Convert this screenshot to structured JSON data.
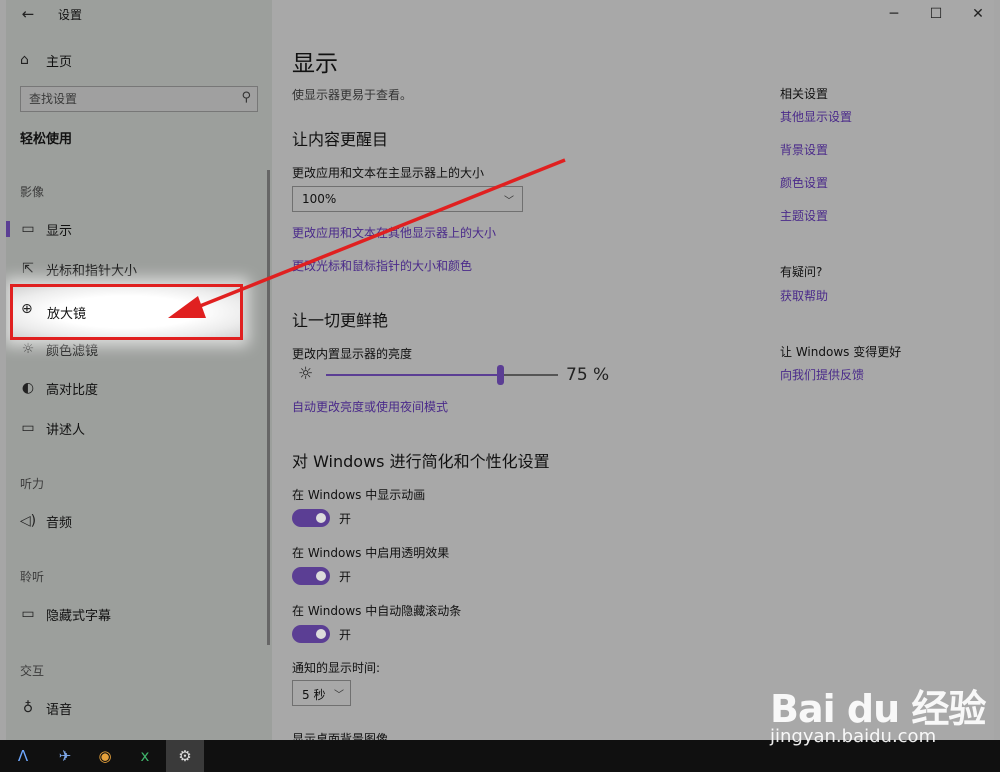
{
  "window": {
    "title": "设置",
    "back_icon": "←",
    "minimize": "─",
    "maximize": "☐",
    "close": "✕"
  },
  "sidebar": {
    "home": {
      "icon": "⌂",
      "label": "主页"
    },
    "search": {
      "placeholder": "查找设置",
      "icon": "⚲"
    },
    "section_title": "轻松使用",
    "categories": {
      "vision": "影像",
      "hearing": "听力",
      "listen": "聆听",
      "interact": "交互"
    },
    "items": [
      {
        "icon": "▭",
        "label": "显示"
      },
      {
        "icon": "⇱",
        "label": "光标和指针大小"
      },
      {
        "icon": "⊕",
        "label": "放大镜"
      },
      {
        "icon": "☼",
        "label": "颜色滤镜"
      },
      {
        "icon": "◐",
        "label": "高对比度"
      },
      {
        "icon": "▭",
        "label": "讲述人"
      },
      {
        "icon": "◁)",
        "label": "音频"
      },
      {
        "icon": "▭",
        "label": "隐藏式字幕"
      },
      {
        "icon": "♁",
        "label": "语音"
      }
    ],
    "selected_index": 0,
    "highlighted_index": 2
  },
  "main": {
    "title": "显示",
    "subtitle": "使显示器更易于查看。",
    "section1": {
      "heading": "让内容更醒目",
      "size_label": "更改应用和文本在主显示器上的大小",
      "size_value": "100%",
      "link1": "更改应用和文本在其他显示器上的大小",
      "link2": "更改光标和鼠标指针的大小和颜色"
    },
    "section2": {
      "heading": "让一切更鲜艳",
      "brightness_label": "更改内置显示器的亮度",
      "brightness_value": 75,
      "brightness_text": "75 %",
      "link": "自动更改亮度或使用夜间模式"
    },
    "section3": {
      "heading": "对 Windows 进行简化和个性化设置",
      "toggles": [
        {
          "label": "在 Windows 中显示动画",
          "state": "开"
        },
        {
          "label": "在 Windows 中启用透明效果",
          "state": "开"
        },
        {
          "label": "在 Windows 中自动隐藏滚动条",
          "state": "开"
        }
      ],
      "notify_label": "通知的显示时间:",
      "notify_value": "5 秒",
      "next_label": "显示桌面背景图像"
    }
  },
  "related": {
    "heading": "相关设置",
    "links": [
      "其他显示设置",
      "背景设置",
      "颜色设置",
      "主题设置"
    ],
    "help_heading": "有疑问?",
    "help_link": "获取帮助",
    "feedback_heading": "让 Windows 变得更好",
    "feedback_link": "向我们提供反馈"
  },
  "taskbar": {
    "apps": [
      {
        "name": "arch-icon",
        "glyph": "Λ"
      },
      {
        "name": "bird-icon",
        "glyph": "✈"
      },
      {
        "name": "media-player-icon",
        "glyph": "◉"
      },
      {
        "name": "excel-icon",
        "glyph": "x"
      },
      {
        "name": "settings-icon",
        "glyph": "⚙"
      }
    ]
  },
  "watermark": {
    "logo": "Bai du 经验",
    "url": "jingyan.baidu.com"
  },
  "colors": {
    "accent": "#5b3e94",
    "link": "#4a2a8a",
    "annotation": "#e02020"
  }
}
